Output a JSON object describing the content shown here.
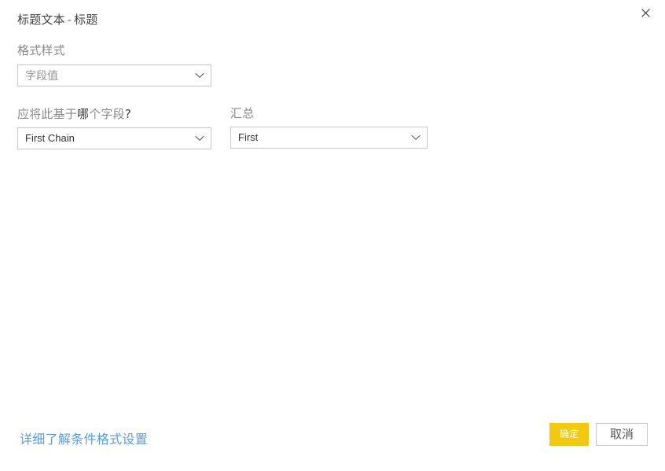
{
  "dialog": {
    "title_main": "标题文本",
    "title_separator": "-",
    "title_sub": "标题",
    "close_icon": "close-icon"
  },
  "format_style": {
    "label": "格式样式",
    "dropdown": {
      "value": "字段值",
      "chevron_icon": "chevron-down-icon"
    }
  },
  "base_field": {
    "label_part1": "应将此基于",
    "label_emphasis": "哪",
    "label_part2": "个字段",
    "label_question": "?",
    "dropdown": {
      "value": "First Chain",
      "chevron_icon": "chevron-down-icon"
    }
  },
  "summarization": {
    "label": "汇总",
    "dropdown": {
      "value": "First",
      "chevron_icon": "chevron-down-icon"
    }
  },
  "footer": {
    "help_link": "详细了解条件格式设置",
    "ok_label": "确定",
    "cancel_label": "取消"
  },
  "colors": {
    "accent_yellow": "#f2c811",
    "link_blue": "#5a9bd5",
    "border_gray": "#c8c8c8",
    "label_gray": "#8a8a8a",
    "text_dark": "#333333",
    "background": "#ffffff"
  }
}
